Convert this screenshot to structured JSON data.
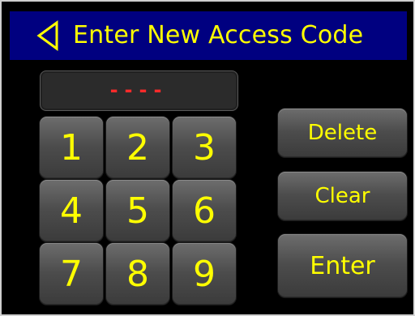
{
  "header": {
    "title": "Enter New Access Code"
  },
  "display": {
    "code": "----"
  },
  "keypad": {
    "keys": [
      "1",
      "2",
      "3",
      "4",
      "5",
      "6",
      "7",
      "8",
      "9"
    ]
  },
  "actions": {
    "delete_label": "Delete",
    "clear_label": "Clear",
    "enter_label": "Enter"
  },
  "colors": {
    "header_bg": "#000080",
    "text_yellow": "#ffff00",
    "code_red": "#ff2a2a"
  },
  "icons": {
    "back": "back-icon"
  }
}
